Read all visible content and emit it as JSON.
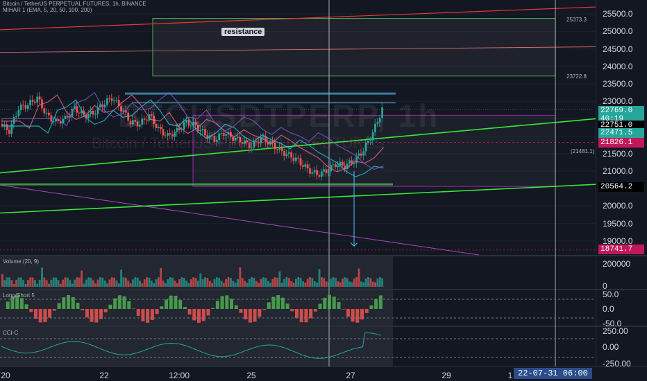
{
  "header": {
    "title": "Bitcoin / TetherUS PERPETUAL FUTURES, 1h, BINANCE",
    "indicator": "MIHAR 1 (EMA, 5, 20, 50, 100, 200)"
  },
  "watermark": {
    "symbol": "BTCUSDTPERP, 1h",
    "name": "Bitcoin / TetherUS PERPETUAL FUTURES"
  },
  "annotations": {
    "resistance_label": "resistance",
    "box_top": "25373.3",
    "box_bottom": "23722.8",
    "mid_level": "(21481.1)"
  },
  "panes": {
    "volume_label": "Volume (20, 9)",
    "longshort_label": "Long/Short 5",
    "cci_label": "CCI-C"
  },
  "price_badges": [
    {
      "value": "22769.0",
      "sub": "40:19",
      "color": "#26a69a"
    },
    {
      "value": "22751.0",
      "color": "#131722"
    },
    {
      "value": "22471.5",
      "color": "#26a69a"
    },
    {
      "value": "21826.1",
      "color": "#c2185b"
    },
    {
      "value": "20564.2",
      "color": "#131722"
    },
    {
      "value": "18741.7",
      "color": "#c2185b"
    }
  ],
  "x_marker": "22-07-31   06:00",
  "chart_data": {
    "type": "candlestick",
    "price_axis": {
      "ticks": [
        "25500.0",
        "25000.0",
        "24500.0",
        "24000.0",
        "23500.0",
        "23000.0",
        "22500.0",
        "22000.0",
        "21500.0",
        "21000.0",
        "20500.0",
        "20000.0",
        "19500.0",
        "19000.0"
      ],
      "ylim": [
        18600,
        25900
      ]
    },
    "volume_axis": {
      "ticks": [
        "200000",
        "0"
      ]
    },
    "longshort_axis": {
      "ticks": [
        "50.0",
        "0.0",
        "-50.0"
      ]
    },
    "cci_axis": {
      "ticks": [
        "250.00",
        "0.00",
        "-250.00"
      ]
    },
    "x_ticks": [
      "20",
      "22",
      "12:00",
      "25",
      "27",
      "29",
      "1"
    ],
    "close_path": [
      22350,
      22150,
      22800,
      22900,
      23100,
      22600,
      22400,
      22500,
      22800,
      22600,
      22650,
      22900,
      23100,
      22800,
      22400,
      22350,
      22600,
      22200,
      22000,
      22150,
      22400,
      22300,
      22050,
      21900,
      22100,
      21950,
      21850,
      21700,
      21950,
      21800,
      21600,
      21450,
      21300,
      21050,
      20900,
      21000,
      21200,
      21150,
      21300,
      21600,
      22100,
      22769
    ],
    "levels": [
      25373.3,
      23722.8,
      21481.1,
      22751.0,
      20564.2,
      18741.7
    ]
  }
}
